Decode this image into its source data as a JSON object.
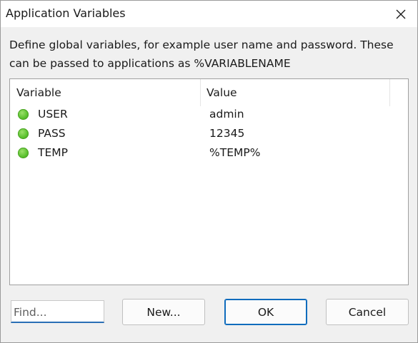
{
  "window": {
    "title": "Application Variables"
  },
  "description": {
    "line1": "Define global variables, for example user name and password. These",
    "line2": "can be passed to applications as %VARIABLENAME"
  },
  "table": {
    "columns": [
      "Variable",
      "Value"
    ],
    "rows": [
      {
        "variable": "USER",
        "value": "admin",
        "status_color": "#5cc230"
      },
      {
        "variable": "PASS",
        "value": "12345",
        "status_color": "#5cc230"
      },
      {
        "variable": "TEMP",
        "value": "%TEMP%",
        "status_color": "#5cc230"
      }
    ]
  },
  "find": {
    "placeholder": "Find..."
  },
  "buttons": {
    "new": "New...",
    "ok": "OK",
    "cancel": "Cancel"
  },
  "icons": {
    "close": "close-icon",
    "status": "green-status-dot-icon"
  },
  "colors": {
    "accent": "#0f6cbd",
    "dialog_bg": "#f0f0f0"
  }
}
